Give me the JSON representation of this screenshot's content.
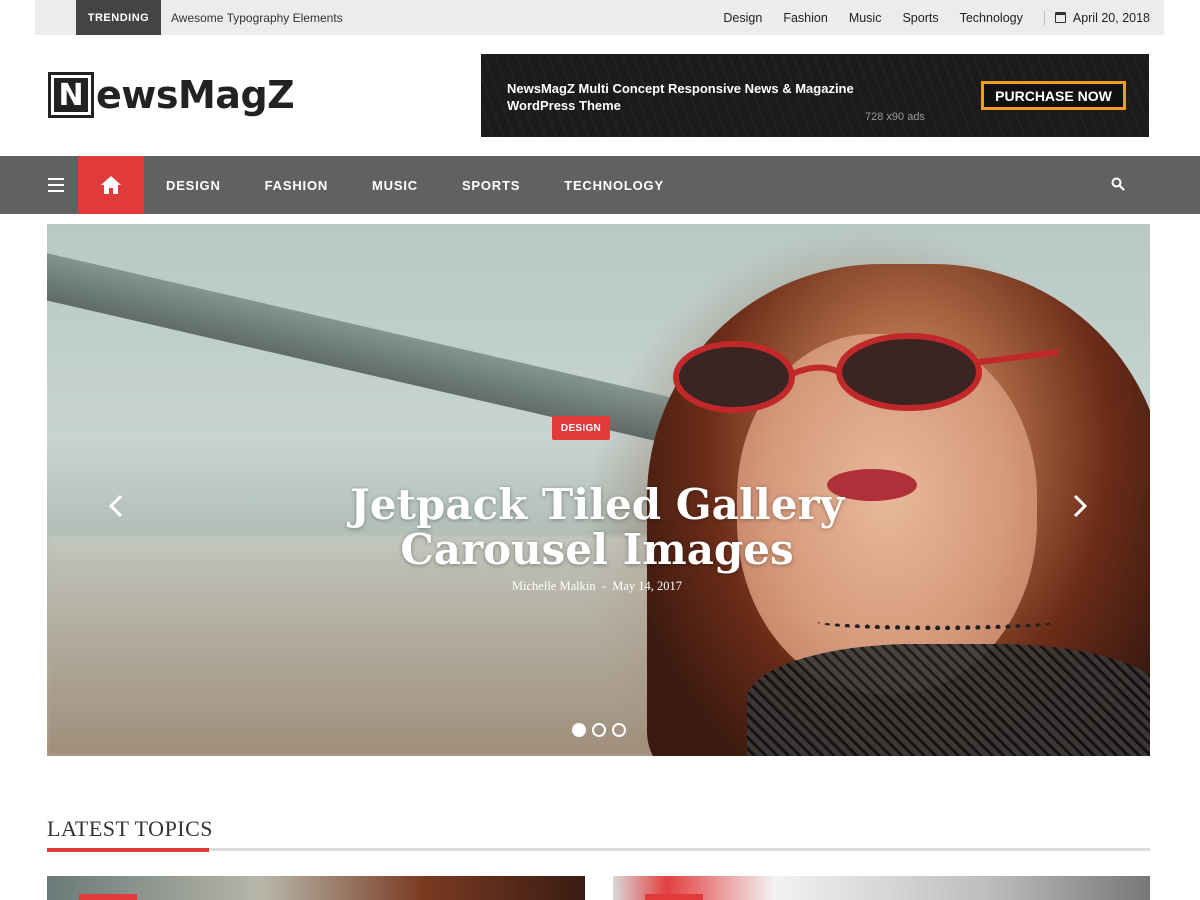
{
  "topbar": {
    "trending_label": "TRENDING",
    "trending_text": "Awesome Typography Elements",
    "links": [
      "Design",
      "Fashion",
      "Music",
      "Sports",
      "Technology"
    ],
    "date": "April 20, 2018"
  },
  "header": {
    "logo_letter": "N",
    "logo_text": "ewsMagZ"
  },
  "ad": {
    "text": "NewsMagZ Multi Concept Responsive News & Magazine WordPress Theme",
    "size": "728 x90 ads",
    "button": "PURCHASE NOW"
  },
  "nav": {
    "items": [
      "DESIGN",
      "FASHION",
      "MUSIC",
      "SPORTS",
      "TECHNOLOGY"
    ]
  },
  "hero": {
    "category": "DESIGN",
    "title": "Jetpack Tiled Gallery Carousel Images",
    "author": "Michelle Malkin",
    "separator": "-",
    "date": "May 14, 2017",
    "slide_count": 3,
    "active_slide": 1
  },
  "latest": {
    "title": "LATEST TOPICS"
  },
  "colors": {
    "accent": "#e03a3a",
    "nav_bg": "#616161",
    "topbar_bg": "#ececec",
    "ad_button_border": "#f29c1f"
  },
  "icons": [
    "calendar-icon",
    "hamburger-menu-icon",
    "home-icon",
    "search-icon",
    "chevron-left-icon",
    "chevron-right-icon"
  ]
}
